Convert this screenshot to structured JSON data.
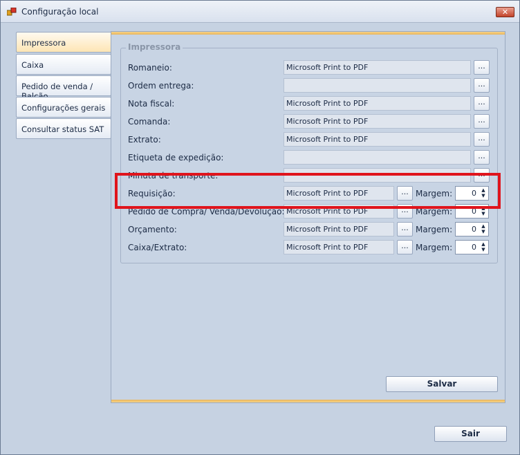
{
  "window": {
    "title": "Configuração local",
    "close_glyph": "✕",
    "icon": "app-icon"
  },
  "tabs": [
    {
      "label": "Impressora",
      "active": true
    },
    {
      "label": "Caixa",
      "active": false
    },
    {
      "label": "Pedido de venda / Balcão",
      "active": false
    },
    {
      "label": "Configurações gerais",
      "active": false
    },
    {
      "label": "Consultar status SAT",
      "active": false
    }
  ],
  "group": {
    "legend": "Impressora",
    "browse_label": "...",
    "margin_label": "Margem:",
    "rows": [
      {
        "label": "Romaneio:",
        "value": "Microsoft Print to PDF"
      },
      {
        "label": "Ordem entrega:",
        "value": ""
      },
      {
        "label": "Nota fiscal:",
        "value": "Microsoft Print to PDF"
      },
      {
        "label": "Comanda:",
        "value": "Microsoft Print to PDF"
      },
      {
        "label": "Extrato:",
        "value": "Microsoft Print to PDF"
      },
      {
        "label": "Etiqueta de expedição:",
        "value": ""
      },
      {
        "label": "Minuta de transporte:",
        "value": ""
      },
      {
        "label": "Requisição:",
        "value": "Microsoft Print to PDF",
        "margin": "0"
      },
      {
        "label": "Pedido de Compra/ Venda/Devolução:",
        "value": "Microsoft Print to PDF",
        "margin": "0"
      },
      {
        "label": "Orçamento:",
        "value": "Microsoft Print to PDF",
        "margin": "0"
      },
      {
        "label": "Caixa/Extrato:",
        "value": "Microsoft Print to PDF",
        "margin": "0"
      }
    ]
  },
  "buttons": {
    "save": "Salvar",
    "exit": "Sair"
  },
  "colors": {
    "highlight": "#e0141c",
    "accent": "#e8b55b"
  }
}
